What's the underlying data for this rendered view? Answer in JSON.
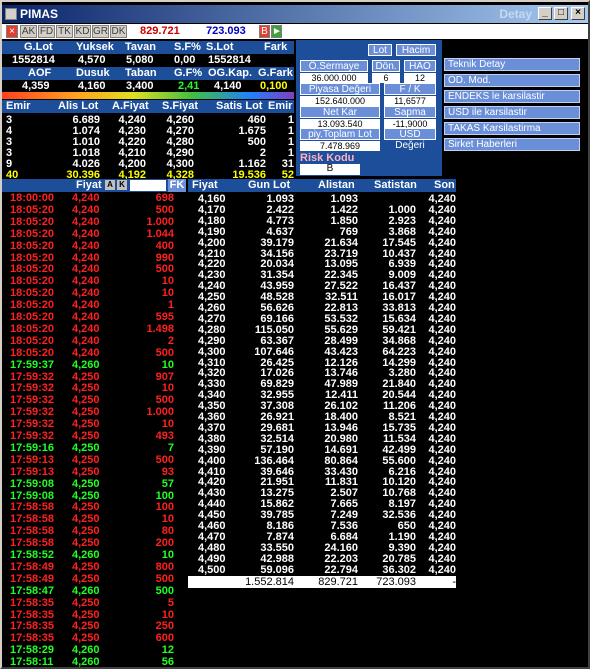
{
  "window": {
    "title": "PIMAS",
    "subtitle": "Detay"
  },
  "toolbar": {
    "buttons": [
      "AK",
      "FD",
      "TK",
      "KD",
      "GR",
      "DK"
    ],
    "lot_value": "829.721",
    "price_value": "723.093",
    "b_label": "B"
  },
  "summary": {
    "row1_headers": [
      "G.Lot",
      "Yuksek",
      "Tavan",
      "S.F%",
      "S.Lot",
      "Fark"
    ],
    "row1_values": [
      "1552814",
      "4,570",
      "5,080",
      "0,00",
      "1552814",
      ""
    ],
    "row2_headers": [
      "AOF",
      "Dusuk",
      "Taban",
      "G.F%",
      "OG.Kap.",
      "G.Fark"
    ],
    "row2_values": [
      "4,359",
      "4,160",
      "3,400",
      "2,41",
      "4,140",
      "0,100"
    ]
  },
  "depth": {
    "headers": [
      "Emir",
      "Alis Lot",
      "A.Fiyat",
      "S.Fiyat",
      "Satis Lot",
      "Emir"
    ],
    "rows": [
      [
        "3",
        "6.689",
        "4,240",
        "4,260",
        "460",
        "1"
      ],
      [
        "4",
        "1.074",
        "4,230",
        "4,270",
        "1.675",
        "1"
      ],
      [
        "3",
        "1.010",
        "4,220",
        "4,280",
        "500",
        "1"
      ],
      [
        "3",
        "1.018",
        "4,210",
        "4,290",
        "2",
        "1"
      ],
      [
        "9",
        "4.026",
        "4,200",
        "4,300",
        "1.162",
        "31"
      ]
    ],
    "total": [
      "40",
      "30.396",
      "4,192",
      "4,328",
      "19.536",
      "52"
    ]
  },
  "info_panel": {
    "lot_btn": "Lot",
    "hacim_btn": "Hacim",
    "sermaye_label": "Ö.Sermaye",
    "sermaye_value": "36.000.000",
    "don_label": "Dön.",
    "don_value": "6",
    "hao_label": "HAO",
    "hao_value": "12",
    "piyasa_label": "Piyasa Değeri",
    "piyasa_value": "152.640.000",
    "fk_label": "F / K",
    "fk_value": "11,6577",
    "netkar_label": "Net Kar",
    "netkar_value": "13.093.540",
    "sapma_label": "Sapma",
    "sapma_value": "-11,9000",
    "ptoplam_label": "piy.Toplam Lot",
    "ptoplam_value": "7.478.969",
    "usd_label": "USD Değeri",
    "risk_label": "Risk Kodu",
    "risk_value": "B"
  },
  "right_menu": [
    "Teknik Detay",
    "OD. Mod.",
    "ENDEKS le karsilastir",
    "USD ile karsilastir",
    "TAKAS Karsilastirma",
    "Sirket Haberleri"
  ],
  "trades": {
    "headers": [
      "Fiyat",
      "FK"
    ],
    "rows": [
      [
        "18:00:00",
        "4,240",
        "698",
        "r"
      ],
      [
        "18:05:20",
        "4,240",
        "500",
        "r"
      ],
      [
        "18:05:20",
        "4,240",
        "1.000",
        "r"
      ],
      [
        "18:05:20",
        "4,240",
        "1.044",
        "r"
      ],
      [
        "18:05:20",
        "4,240",
        "400",
        "r"
      ],
      [
        "18:05:20",
        "4,240",
        "990",
        "r"
      ],
      [
        "18:05:20",
        "4,240",
        "500",
        "r"
      ],
      [
        "18:05:20",
        "4,240",
        "10",
        "r"
      ],
      [
        "18:05:20",
        "4,240",
        "10",
        "r"
      ],
      [
        "18:05:20",
        "4,240",
        "1",
        "r"
      ],
      [
        "18:05:20",
        "4,240",
        "595",
        "r"
      ],
      [
        "18:05:20",
        "4,240",
        "1.498",
        "r"
      ],
      [
        "18:05:20",
        "4,240",
        "2",
        "r"
      ],
      [
        "18:05:20",
        "4,240",
        "500",
        "r"
      ],
      [
        "17:59:37",
        "4,260",
        "10",
        "g"
      ],
      [
        "17:59:32",
        "4,250",
        "907",
        "r"
      ],
      [
        "17:59:32",
        "4,250",
        "10",
        "r"
      ],
      [
        "17:59:32",
        "4,250",
        "500",
        "r"
      ],
      [
        "17:59:32",
        "4,250",
        "1.000",
        "r"
      ],
      [
        "17:59:32",
        "4,250",
        "10",
        "r"
      ],
      [
        "17:59:32",
        "4,250",
        "493",
        "r"
      ],
      [
        "17:59:16",
        "4,250",
        "7",
        "g"
      ],
      [
        "17:59:13",
        "4,250",
        "500",
        "r"
      ],
      [
        "17:59:13",
        "4,250",
        "93",
        "r"
      ],
      [
        "17:59:08",
        "4,250",
        "57",
        "g"
      ],
      [
        "17:59:08",
        "4,250",
        "100",
        "g"
      ],
      [
        "17:58:58",
        "4,250",
        "100",
        "r"
      ],
      [
        "17:58:58",
        "4,250",
        "10",
        "r"
      ],
      [
        "17:58:58",
        "4,250",
        "80",
        "r"
      ],
      [
        "17:58:58",
        "4,250",
        "200",
        "r"
      ],
      [
        "17:58:52",
        "4,260",
        "10",
        "g"
      ],
      [
        "17:58:49",
        "4,250",
        "800",
        "r"
      ],
      [
        "17:58:49",
        "4,250",
        "500",
        "r"
      ],
      [
        "17:58:47",
        "4,260",
        "500",
        "g"
      ],
      [
        "17:58:35",
        "4,250",
        "5",
        "r"
      ],
      [
        "17:58:35",
        "4,250",
        "10",
        "r"
      ],
      [
        "17:58:35",
        "4,250",
        "250",
        "r"
      ],
      [
        "17:58:35",
        "4,250",
        "600",
        "r"
      ],
      [
        "17:58:29",
        "4,260",
        "12",
        "g"
      ],
      [
        "17:58:11",
        "4,260",
        "56",
        "g"
      ]
    ]
  },
  "price_table": {
    "headers": [
      "Fiyat",
      "Gun Lot",
      "Alistan",
      "Satistan",
      "Son"
    ],
    "rows": [
      [
        "4,160",
        "1.093",
        "1.093",
        "",
        "4,240"
      ],
      [
        "4,170",
        "2.422",
        "1.422",
        "1.000",
        "4,240"
      ],
      [
        "4,180",
        "4.773",
        "1.850",
        "2.923",
        "4,240"
      ],
      [
        "4,190",
        "4.637",
        "769",
        "3.868",
        "4,240"
      ],
      [
        "4,200",
        "39.179",
        "21.634",
        "17.545",
        "4,240"
      ],
      [
        "4,210",
        "34.156",
        "23.719",
        "10.437",
        "4,240"
      ],
      [
        "4,220",
        "20.034",
        "13.095",
        "6.939",
        "4,240"
      ],
      [
        "4,230",
        "31.354",
        "22.345",
        "9.009",
        "4,240"
      ],
      [
        "4,240",
        "43.959",
        "27.522",
        "16.437",
        "4,240"
      ],
      [
        "4,250",
        "48.528",
        "32.511",
        "16.017",
        "4,240"
      ],
      [
        "4,260",
        "56.626",
        "22.813",
        "33.813",
        "4,240"
      ],
      [
        "4,270",
        "69.166",
        "53.532",
        "15.634",
        "4,240"
      ],
      [
        "4,280",
        "115.050",
        "55.629",
        "59.421",
        "4,240"
      ],
      [
        "4,290",
        "63.367",
        "28.499",
        "34.868",
        "4,240"
      ],
      [
        "4,300",
        "107.646",
        "43.423",
        "64.223",
        "4,240"
      ],
      [
        "4,310",
        "26.425",
        "12.126",
        "14.299",
        "4,240"
      ],
      [
        "4,320",
        "17.026",
        "13.746",
        "3.280",
        "4,240"
      ],
      [
        "4,330",
        "69.829",
        "47.989",
        "21.840",
        "4,240"
      ],
      [
        "4,340",
        "32.955",
        "12.411",
        "20.544",
        "4,240"
      ],
      [
        "4,350",
        "37.308",
        "26.102",
        "11.206",
        "4,240"
      ],
      [
        "4,360",
        "26.921",
        "18.400",
        "8.521",
        "4,240"
      ],
      [
        "4,370",
        "29.681",
        "13.946",
        "15.735",
        "4,240"
      ],
      [
        "4,380",
        "32.514",
        "20.980",
        "11.534",
        "4,240"
      ],
      [
        "4,390",
        "57.190",
        "14.691",
        "42.499",
        "4,240"
      ],
      [
        "4,400",
        "136.464",
        "80.864",
        "55.600",
        "4,240"
      ],
      [
        "4,410",
        "39.646",
        "33.430",
        "6.216",
        "4,240"
      ],
      [
        "4,420",
        "21.951",
        "11.831",
        "10.120",
        "4,240"
      ],
      [
        "4,430",
        "13.275",
        "2.507",
        "10.768",
        "4,240"
      ],
      [
        "4,440",
        "15.862",
        "7.665",
        "8.197",
        "4,240"
      ],
      [
        "4,450",
        "39.785",
        "7.249",
        "32.536",
        "4,240"
      ],
      [
        "4,460",
        "8.186",
        "7.536",
        "650",
        "4,240"
      ],
      [
        "4,470",
        "7.874",
        "6.684",
        "1.190",
        "4,240"
      ],
      [
        "4,480",
        "33.550",
        "24.160",
        "9.390",
        "4,240"
      ],
      [
        "4,490",
        "42.988",
        "22.203",
        "20.785",
        "4,240"
      ],
      [
        "4,500",
        "59.096",
        "22.794",
        "36.302",
        "4,240"
      ]
    ],
    "total": [
      "",
      "1.552.814",
      "829.721",
      "723.093",
      "-"
    ]
  },
  "colors": {
    "header_bg": "#1c4e9a",
    "up": "#22ff22",
    "down": "#ff2020",
    "accent_yellow": "#ffff00"
  }
}
